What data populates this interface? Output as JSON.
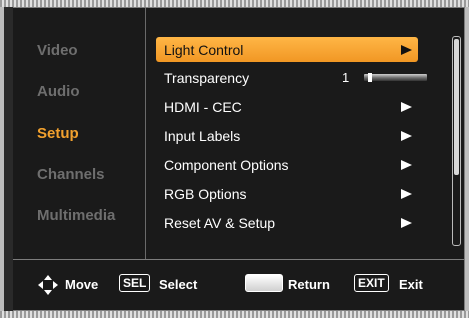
{
  "sidebar": {
    "items": [
      {
        "label": "Video"
      },
      {
        "label": "Audio"
      },
      {
        "label": "Setup"
      },
      {
        "label": "Channels"
      },
      {
        "label": "Multimedia"
      }
    ],
    "active": "Setup"
  },
  "menu": {
    "items": [
      {
        "label": "Light Control",
        "selected": true,
        "icon": "arrow-right-icon"
      },
      {
        "label": "Transparency",
        "value": "1",
        "slider_fraction": 0.05
      },
      {
        "label": "HDMI - CEC",
        "icon": "arrow-right-icon"
      },
      {
        "label": "Input Labels",
        "icon": "arrow-right-icon"
      },
      {
        "label": "Component Options",
        "icon": "arrow-right-icon"
      },
      {
        "label": "RGB Options",
        "icon": "arrow-right-icon"
      },
      {
        "label": "Reset AV & Setup",
        "icon": "arrow-right-icon"
      }
    ]
  },
  "footer": {
    "move_label": "Move",
    "select_key": "SEL",
    "select_label": "Select",
    "return_label": "Return",
    "exit_key": "EXIT",
    "exit_label": "Exit"
  },
  "colors": {
    "accent": "#f2a12e",
    "background": "#1a1a1a",
    "inactive_text": "#6e6e6e"
  }
}
